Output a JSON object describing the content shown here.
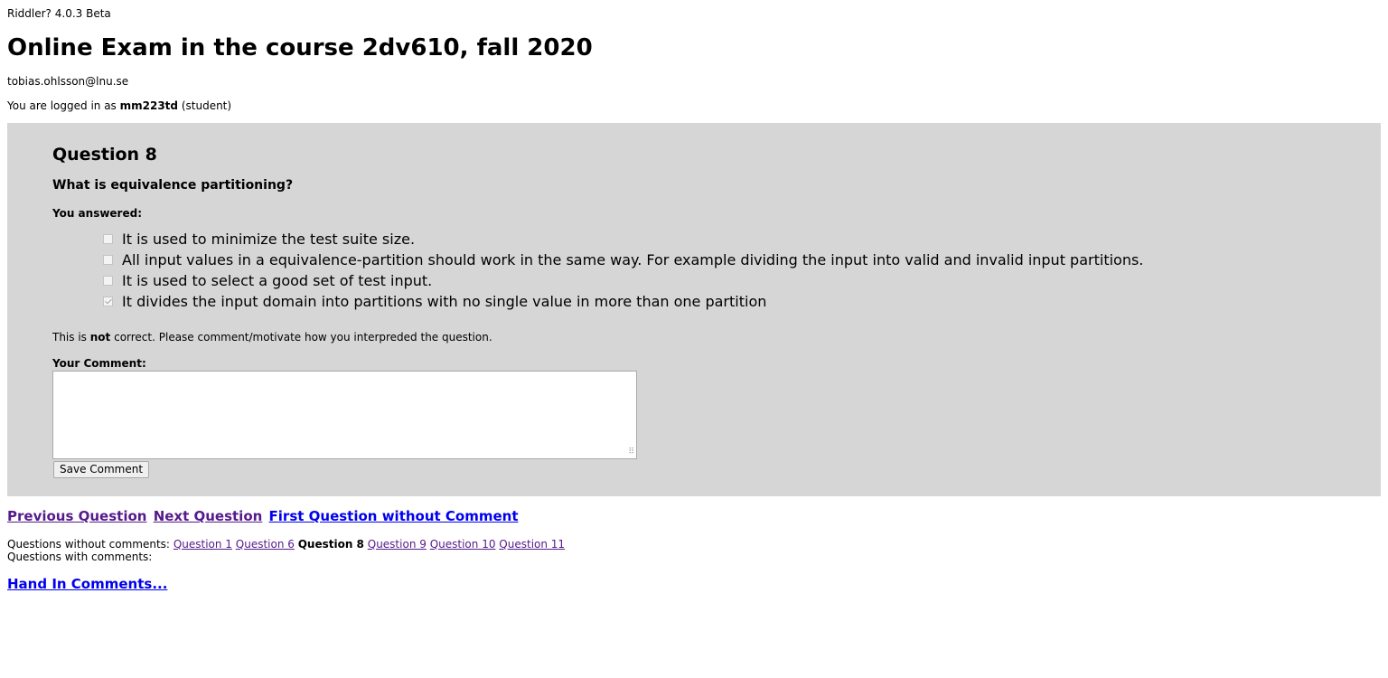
{
  "app": {
    "version": "Riddler? 4.0.3 Beta"
  },
  "exam": {
    "title": "Online Exam in the course 2dv610, fall 2020",
    "owner_email": "tobias.ohlsson@lnu.se"
  },
  "login": {
    "prefix": "You are logged in as ",
    "username": "mm223td",
    "role": " (student)"
  },
  "question": {
    "heading": "Question 8",
    "text": "What is equivalence partitioning?",
    "answered_label": "You answered:",
    "options": [
      {
        "label": "It is used to minimize the test suite size.",
        "checked": false
      },
      {
        "label": "All input values in a equivalence-partition should work in the same way. For example dividing the input into valid and invalid input partitions.",
        "checked": false
      },
      {
        "label": "It is used to select a good set of test input.",
        "checked": false
      },
      {
        "label": "It divides the input domain into partitions with no single value in more than one partition",
        "checked": true
      }
    ],
    "feedback_prefix": "This is ",
    "feedback_emphasis": "not",
    "feedback_suffix": " correct. Please comment/motivate how you interpreded the question.",
    "comment_label": "Your Comment:",
    "comment_value": "",
    "save_label": "Save Comment"
  },
  "navigation": {
    "previous": "Previous Question",
    "next": "Next Question",
    "first_without_comment": "First Question without Comment"
  },
  "comments_status": {
    "without_label": "Questions without comments:",
    "without_items": [
      {
        "label": "Question 1",
        "current": false
      },
      {
        "label": "Question 6",
        "current": false
      },
      {
        "label": "Question 8",
        "current": true
      },
      {
        "label": "Question 9",
        "current": false
      },
      {
        "label": "Question 10",
        "current": false
      },
      {
        "label": "Question 11",
        "current": false
      }
    ],
    "with_label": "Questions with comments:"
  },
  "hand_in": {
    "label": "Hand In Comments..."
  },
  "colors": {
    "panel_background": "#d6d6d6",
    "visited_link": "#551a8b",
    "unvisited_link": "#0000ee"
  }
}
